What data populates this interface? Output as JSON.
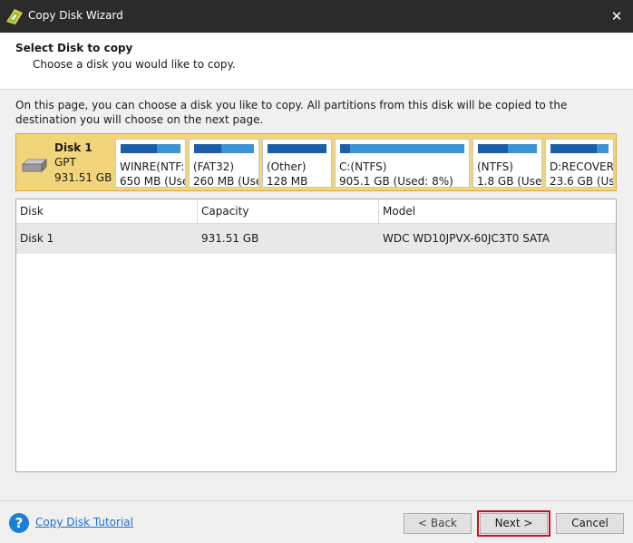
{
  "window": {
    "title": "Copy Disk Wizard",
    "close_glyph": "✕"
  },
  "header": {
    "title": "Select Disk to copy",
    "subtitle": "Choose a disk you would like to copy."
  },
  "description": "On this page, you can choose a disk you like to copy. All partitions from this disk will be copied to the destination you will choose on the next page.",
  "disk": {
    "name": "Disk 1",
    "type": "GPT",
    "size": "931.51 GB"
  },
  "partitions": [
    {
      "name": "WINRE(NTF:",
      "size": "650 MB (Use",
      "used_fraction": 0.6
    },
    {
      "name": "(FAT32)",
      "size": "260 MB (Use",
      "used_fraction": 0.45
    },
    {
      "name": "(Other)",
      "size": "128 MB",
      "used_fraction": 1.0
    },
    {
      "name": "C:(NTFS)",
      "size": "905.1 GB (Used: 8%)",
      "used_fraction": 0.08
    },
    {
      "name": "(NTFS)",
      "size": "1.8 GB (Use",
      "used_fraction": 0.5
    },
    {
      "name": "D:RECOVER",
      "size": "23.6 GB (Use",
      "used_fraction": 0.8
    }
  ],
  "table": {
    "columns": [
      "Disk",
      "Capacity",
      "Model"
    ],
    "rows": [
      {
        "disk": "Disk 1",
        "capacity": "931.51 GB",
        "model": "WDC WD10JPVX-60JC3T0 SATA"
      }
    ]
  },
  "footer": {
    "tutorial_link": "Copy Disk Tutorial",
    "back_label": "< Back",
    "next_label": "Next >",
    "cancel_label": "Cancel"
  }
}
